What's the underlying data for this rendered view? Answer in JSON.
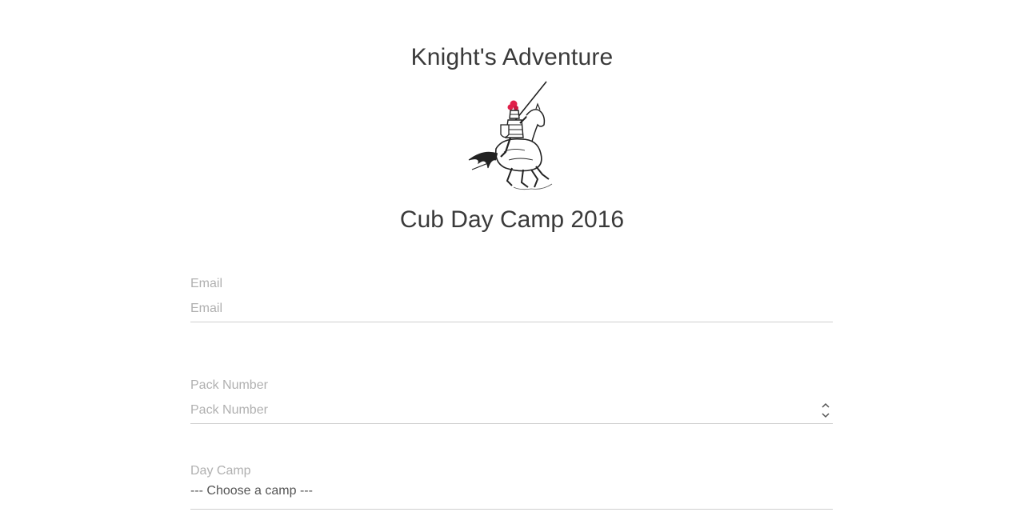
{
  "header": {
    "title": "Knight's Adventure",
    "logo_icon": "knight-on-horse-logo",
    "subtitle": "Cub Day Camp 2016"
  },
  "form": {
    "email": {
      "label": "Email",
      "placeholder": "Email",
      "value": ""
    },
    "pack_number": {
      "label": "Pack Number",
      "placeholder": "Pack Number",
      "value": ""
    },
    "day_camp": {
      "label": "Day Camp",
      "selected": "--- Choose a camp ---"
    }
  },
  "colors": {
    "accent_plume": "#e0204a",
    "text": "#3a3a3a",
    "label": "#b0b0b0",
    "underline": "#cfcfcf"
  }
}
